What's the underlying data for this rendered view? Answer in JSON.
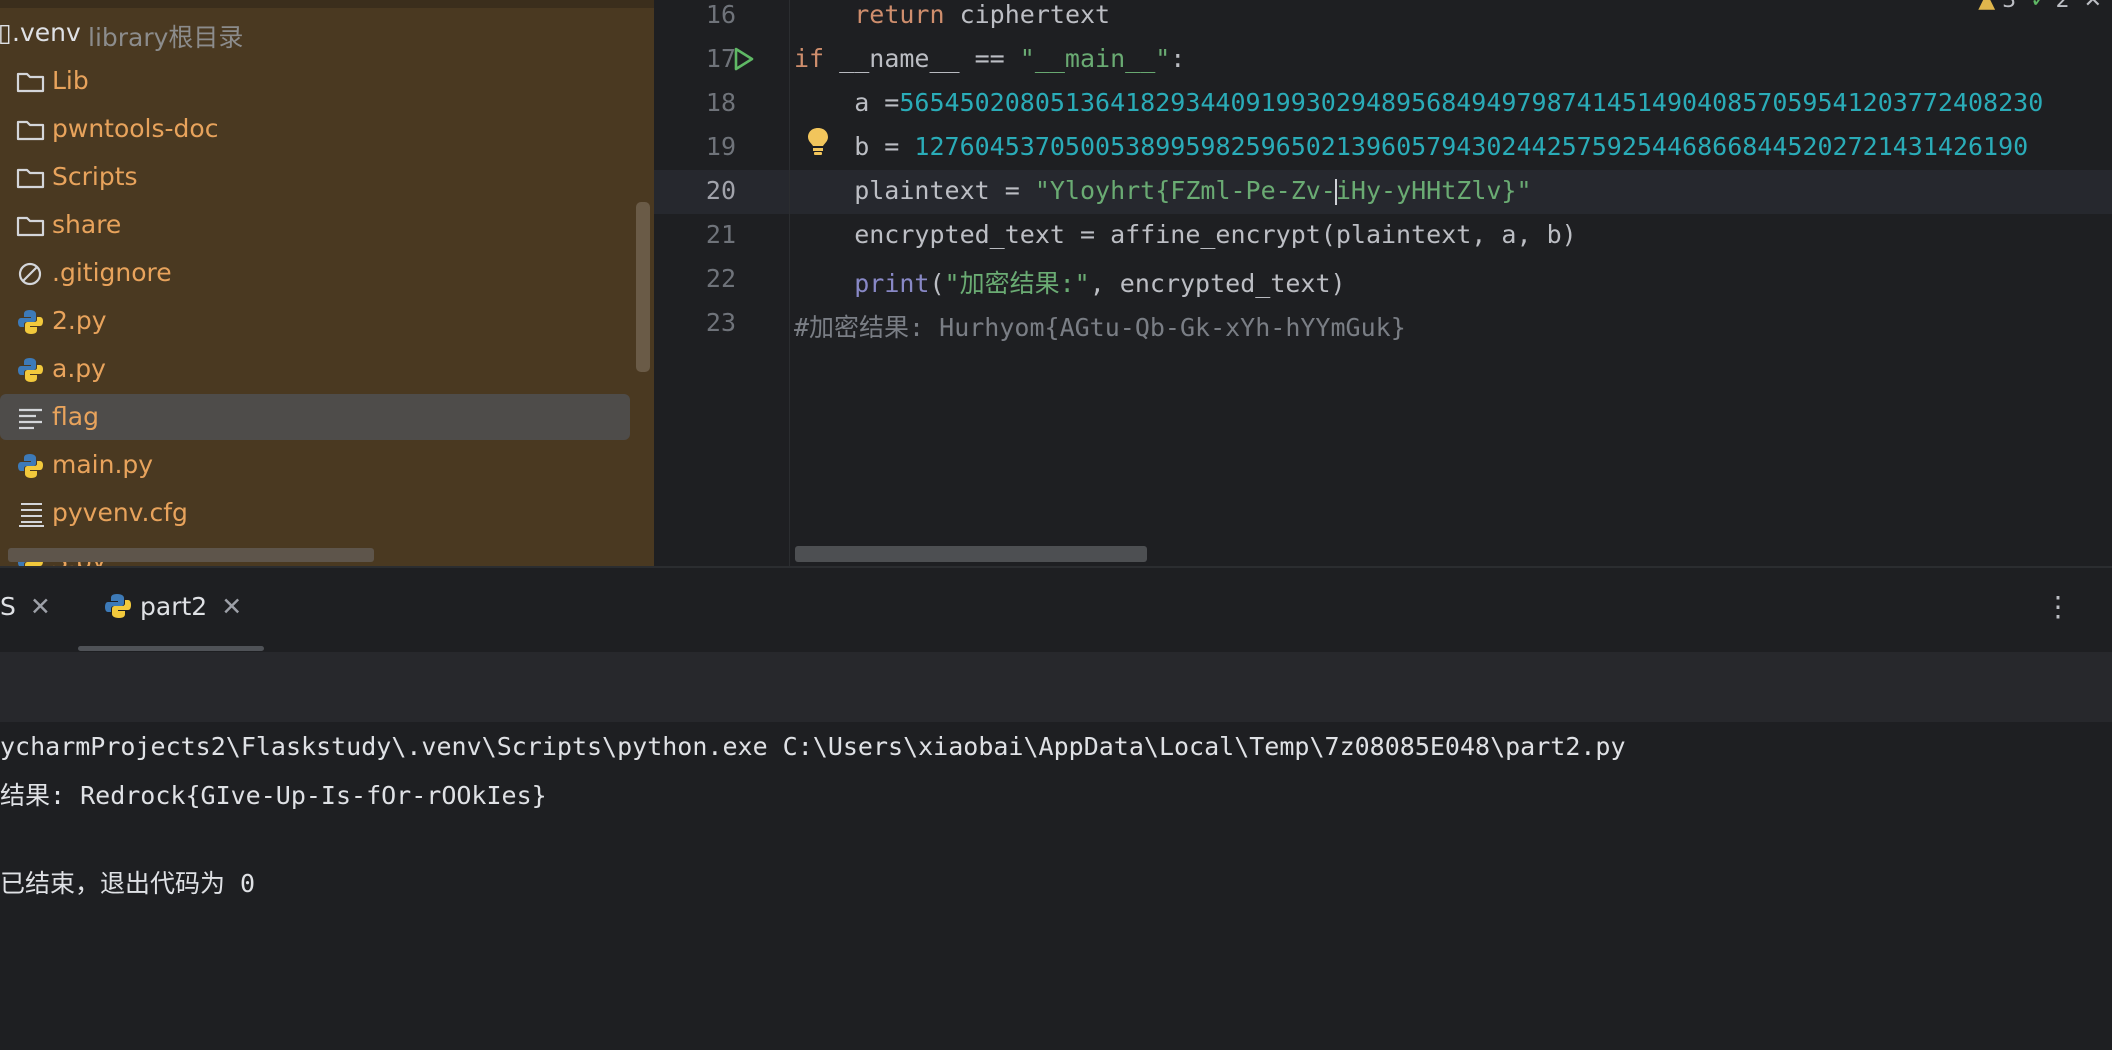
{
  "project_tree": {
    "root": {
      "mark": "▯",
      "name": ".venv",
      "hint": "library根目录"
    },
    "items": [
      {
        "label": "Lib",
        "icon": "folder-icon"
      },
      {
        "label": "pwntools-doc",
        "icon": "folder-icon"
      },
      {
        "label": "Scripts",
        "icon": "folder-icon"
      },
      {
        "label": "share",
        "icon": "folder-icon"
      },
      {
        "label": ".gitignore",
        "icon": "ignore-file-icon"
      },
      {
        "label": "2.py",
        "icon": "python-file-icon"
      },
      {
        "label": "a.py",
        "icon": "python-file-icon"
      },
      {
        "label": "flag",
        "icon": "text-file-icon",
        "selected": true
      },
      {
        "label": "main.py",
        "icon": "python-file-icon"
      },
      {
        "label": "pyvenv.cfg",
        "icon": "config-file-icon"
      },
      {
        "label": "S.py",
        "icon": "python-file-icon"
      }
    ]
  },
  "editor": {
    "inspection": {
      "warnings": "3",
      "typos": "2"
    },
    "lines": [
      {
        "num": "16",
        "parts": [
          [
            "    ",
            "plain"
          ],
          [
            "return",
            "kw"
          ],
          [
            " ciphertext",
            "plain"
          ]
        ]
      },
      {
        "num": "17",
        "parts": [
          [
            "if",
            "kw"
          ],
          [
            " __name__ == ",
            "plain"
          ],
          [
            "\"__main__\"",
            "str"
          ],
          [
            ":",
            "plain"
          ]
        ]
      },
      {
        "num": "18",
        "parts": [
          [
            "    a =",
            "plain"
          ],
          [
            "5654502080513641829344091993029489568494979874145149040857059541203772408230",
            "num"
          ]
        ]
      },
      {
        "num": "19",
        "parts": [
          [
            "    b = ",
            "plain"
          ],
          [
            "12760453705005389959825965021396057943024425759254468668445202721431426190",
            "num"
          ]
        ]
      },
      {
        "num": "20",
        "current": true,
        "parts": [
          [
            "    plaintext = ",
            "plain"
          ],
          [
            "\"Yloyhrt{FZml-Pe-Zv-",
            "str"
          ],
          [
            "|caret|",
            "caret"
          ],
          [
            "iHy-yHHtZlv}\"",
            "str"
          ]
        ]
      },
      {
        "num": "21",
        "parts": [
          [
            "    encrypted_text = affine_encrypt(plaintext, a, b)",
            "plain"
          ]
        ]
      },
      {
        "num": "22",
        "parts": [
          [
            "    ",
            "plain"
          ],
          [
            "print",
            "builtin"
          ],
          [
            "(",
            "plain"
          ],
          [
            "\"加密结果:\"",
            "str"
          ],
          [
            ", encrypted_text)",
            "plain"
          ]
        ]
      },
      {
        "num": "23",
        "parts": [
          [
            "#加密结果: Hurhyom{AGtu-Qb-Gk-xYh-hYYmGuk}",
            "comment"
          ]
        ]
      }
    ]
  },
  "run_window": {
    "tabs": [
      {
        "label": "S",
        "close": "✕"
      },
      {
        "label": "part2",
        "close": "✕",
        "active": true
      }
    ],
    "more": "⋮",
    "output": [
      "ycharmProjects2\\Flaskstudy\\.venv\\Scripts\\python.exe C:\\Users\\xiaobai\\AppData\\Local\\Temp\\7z08085E048\\part2.py",
      "结果: Redrock{GIve-Up-Is-fOr-rOOkIes}",
      "",
      "已结束，退出代码为 0"
    ]
  },
  "colors": {
    "project_bg": "#4a3921",
    "tree_label": "#e8a35c",
    "editor_bg": "#1e1f22",
    "keyword": "#cf8e6d",
    "number": "#2aacb8",
    "string": "#6aab73"
  }
}
